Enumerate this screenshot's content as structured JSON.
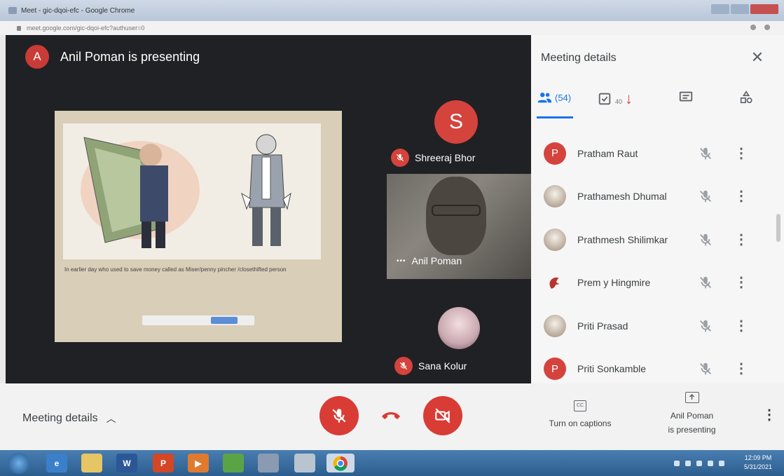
{
  "browser": {
    "window_title": "Meet - gic-dqoi-efc - Google Chrome",
    "url": "meet.google.com/gic-dqoi-efc?authuser=0"
  },
  "stage": {
    "presenter_initial": "A",
    "presenting_text": "Anil Poman is presenting",
    "slide_caption": "In earlier day who used to save money called as Miser/penny pincher /closethifted person"
  },
  "participants_tiles": [
    {
      "initial": "S",
      "name": "Shreeraj Bhor"
    },
    {
      "name": "Anil Poman"
    },
    {
      "name": "Sana Kolur"
    }
  ],
  "panel": {
    "title": "Meeting details",
    "people_count": "(54)",
    "tasks_count": "40",
    "people": [
      {
        "initial": "P",
        "name": "Pratham Raut",
        "avatar": "letter"
      },
      {
        "name": "Prathamesh Dhumal",
        "avatar": "photo"
      },
      {
        "name": "Prathmesh Shilimkar",
        "avatar": "photo"
      },
      {
        "name": "Prem y Hingmire",
        "avatar": "photo"
      },
      {
        "name": "Priti Prasad",
        "avatar": "photo"
      },
      {
        "initial": "P",
        "name": "Priti Sonkamble",
        "avatar": "letter"
      }
    ]
  },
  "bottom": {
    "meeting_details": "Meeting details",
    "captions_label": "Turn on captions",
    "cc_glyph": "CC",
    "presenting_line1": "Anil Poman",
    "presenting_line2": "is presenting"
  },
  "taskbar": {
    "time": "12:09 PM",
    "date": "5/31/2021",
    "apps": [
      "W",
      "P"
    ]
  },
  "colors": {
    "red": "#d93b35",
    "blue": "#1a73e8",
    "stage_bg": "#202124"
  }
}
